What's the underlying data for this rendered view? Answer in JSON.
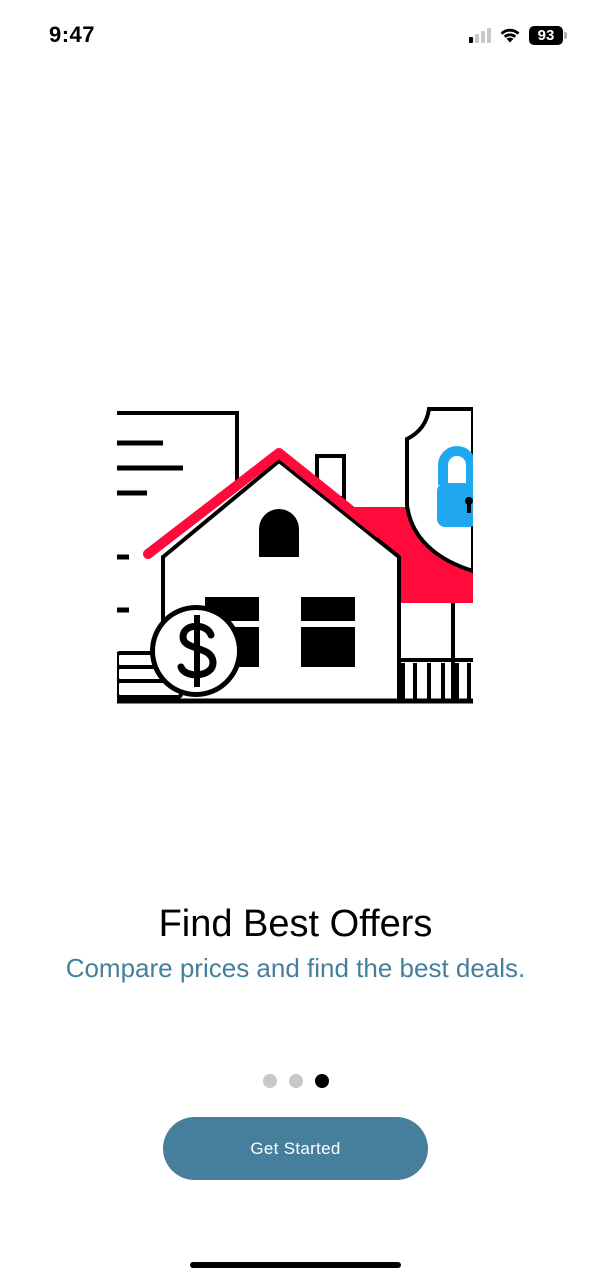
{
  "status_bar": {
    "time": "9:47",
    "battery": "93",
    "icons": [
      "signal-icon",
      "wifi-icon",
      "battery-icon"
    ]
  },
  "onboarding": {
    "illustration": "house-with-dollar-coin-and-lock-shield-illustration",
    "title": "Find Best Offers",
    "subtitle": "Compare prices and find the best deals.",
    "page_count": 3,
    "active_page": 3,
    "cta_label": "Get Started"
  },
  "colors": {
    "accent": "#467f9c",
    "roof_red": "#ff0a3a",
    "lock_blue": "#1fa8ef",
    "dot_inactive": "#c8c8c8",
    "dot_active": "#000000"
  }
}
